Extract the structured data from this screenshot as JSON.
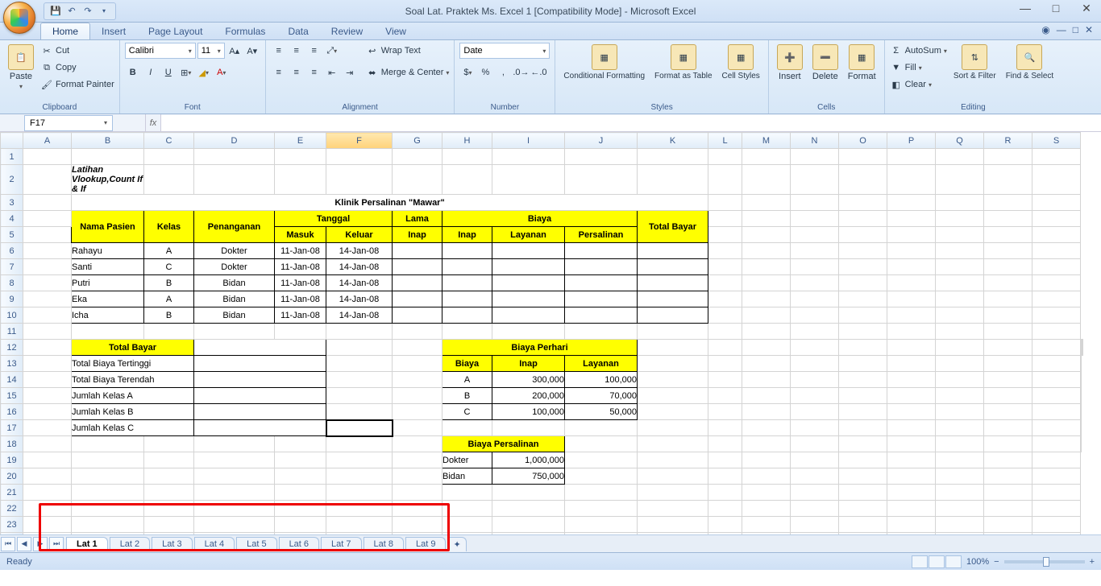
{
  "window": {
    "title": "Soal Lat. Praktek Ms. Excel 1  [Compatibility Mode] - Microsoft Excel"
  },
  "ribbon": {
    "tabs": [
      "Home",
      "Insert",
      "Page Layout",
      "Formulas",
      "Data",
      "Review",
      "View"
    ],
    "active_tab": "Home",
    "clipboard": {
      "paste": "Paste",
      "cut": "Cut",
      "copy": "Copy",
      "fp": "Format Painter",
      "label": "Clipboard"
    },
    "font": {
      "name": "Calibri",
      "size": "11",
      "label": "Font"
    },
    "alignment": {
      "wrap": "Wrap Text",
      "merge": "Merge & Center",
      "label": "Alignment"
    },
    "number": {
      "format": "Date",
      "label": "Number"
    },
    "styles": {
      "cond": "Conditional Formatting",
      "fmt": "Format as Table",
      "cell": "Cell Styles",
      "label": "Styles"
    },
    "cells": {
      "insert": "Insert",
      "delete": "Delete",
      "format": "Format",
      "label": "Cells"
    },
    "editing": {
      "sum": "AutoSum",
      "fill": "Fill",
      "clear": "Clear",
      "sort": "Sort & Filter",
      "find": "Find & Select",
      "label": "Editing"
    }
  },
  "namebox": "F17",
  "columns": [
    "A",
    "B",
    "C",
    "D",
    "E",
    "F",
    "G",
    "H",
    "I",
    "J",
    "K",
    "L",
    "M",
    "N",
    "O",
    "P",
    "Q",
    "R",
    "S"
  ],
  "sheet": {
    "r2b": "Latihan Vlookup,Count If & If",
    "r3": "Klinik Persalinan \"Mawar\"",
    "hdr": {
      "nama": "Nama Pasien",
      "kelas": "Kelas",
      "pen": "Penanganan",
      "tgl": "Tanggal",
      "masuk": "Masuk",
      "keluar": "Keluar",
      "lama": "Lama",
      "inap": "Inap",
      "biaya": "Biaya",
      "layanan": "Layanan",
      "pers": "Persalinan",
      "total": "Total Bayar"
    },
    "rows": [
      {
        "n": "Rahayu",
        "k": "A",
        "p": "Dokter",
        "m": "11-Jan-08",
        "o": "14-Jan-08"
      },
      {
        "n": "Santi",
        "k": "C",
        "p": "Dokter",
        "m": "11-Jan-08",
        "o": "14-Jan-08"
      },
      {
        "n": "Putri",
        "k": "B",
        "p": "Bidan",
        "m": "11-Jan-08",
        "o": "14-Jan-08"
      },
      {
        "n": "Eka",
        "k": "A",
        "p": "Bidan",
        "m": "11-Jan-08",
        "o": "14-Jan-08"
      },
      {
        "n": "Icha",
        "k": "B",
        "p": "Bidan",
        "m": "11-Jan-08",
        "o": "14-Jan-08"
      }
    ],
    "summary": {
      "tb": "Total Bayar",
      "tt": "Total Biaya Tertinggi",
      "tr": "Total Biaya Terendah",
      "ja": "Jumlah Kelas A",
      "jb": "Jumlah Kelas B",
      "jc": "Jumlah Kelas C"
    },
    "perhari": {
      "title": "Biaya Perhari",
      "biaya": "Biaya",
      "inap": "Inap",
      "layanan": "Layanan",
      "r": [
        {
          "k": "A",
          "i": "300,000",
          "l": "100,000"
        },
        {
          "k": "B",
          "i": "200,000",
          "l": "70,000"
        },
        {
          "k": "C",
          "i": "100,000",
          "l": "50,000"
        }
      ]
    },
    "persalinan": {
      "title": "Biaya Persalinan",
      "r": [
        {
          "k": "Dokter",
          "v": "1,000,000"
        },
        {
          "k": "Bidan",
          "v": "750,000"
        }
      ]
    }
  },
  "tabs": [
    "Lat 1",
    "Lat 2",
    "Lat 3",
    "Lat 4",
    "Lat 5",
    "Lat 6",
    "Lat 7",
    "Lat 8",
    "Lat 9"
  ],
  "status": {
    "ready": "Ready",
    "zoom": "100%"
  }
}
